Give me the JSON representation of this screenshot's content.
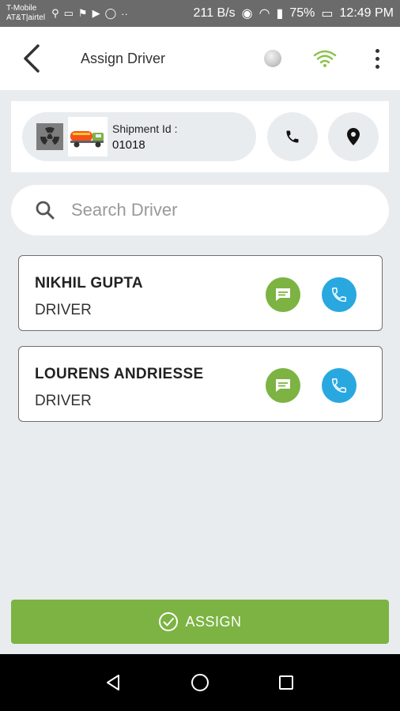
{
  "status_bar": {
    "carrier_line1": "T-Mobile",
    "carrier_line2": "AT&T|airtel",
    "net_speed": "211 B/s",
    "battery": "75%",
    "time": "12:49 PM"
  },
  "app_bar": {
    "title": "Assign Driver"
  },
  "shipment": {
    "label": "Shipment Id :",
    "id": "01018"
  },
  "search": {
    "placeholder": "Search Driver"
  },
  "drivers": [
    {
      "name": "NIKHIL GUPTA",
      "role": "DRIVER"
    },
    {
      "name": "LOURENS ANDRIESSE",
      "role": "DRIVER"
    }
  ],
  "assign": {
    "label": "ASSIGN"
  },
  "colors": {
    "accent_green": "#7cb342",
    "call_blue": "#29a8e0",
    "background": "#e9ecef"
  },
  "icons": [
    "back-arrow-icon",
    "status-dot-icon",
    "wifi-icon",
    "more-vert-icon",
    "hazard-icon",
    "truck-icon",
    "phone-icon",
    "location-pin-icon",
    "search-icon",
    "message-icon",
    "check-circle-icon",
    "nav-back-icon",
    "nav-home-icon",
    "nav-recents-icon"
  ]
}
